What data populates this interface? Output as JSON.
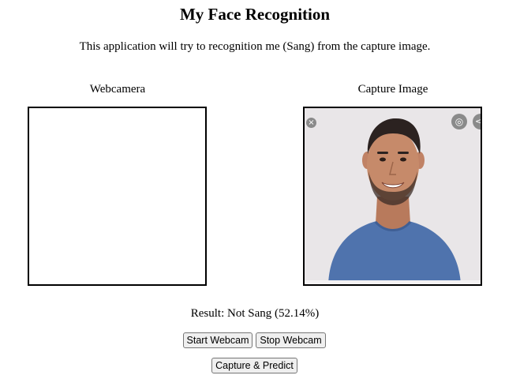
{
  "page": {
    "title": "My Face Recognition",
    "description": "This application will try to recognition me (Sang) from the capture image."
  },
  "webcam": {
    "label": "Webcamera"
  },
  "capture": {
    "label": "Capture Image",
    "image_subject": "smiling man in blue t-shirt",
    "overlay_icons": [
      "close-icon",
      "lens-search-icon",
      "share-icon"
    ]
  },
  "result": {
    "text": "Result: Not Sang (52.14%)"
  },
  "controls": {
    "start_webcam": "Start Webcam",
    "stop_webcam": "Stop Webcam",
    "capture_predict": "Capture & Predict"
  },
  "colors": {
    "shirt": "#4f73ad",
    "background": "#e9e6e8",
    "skin": "#c68a6a",
    "hair": "#2b2220"
  }
}
